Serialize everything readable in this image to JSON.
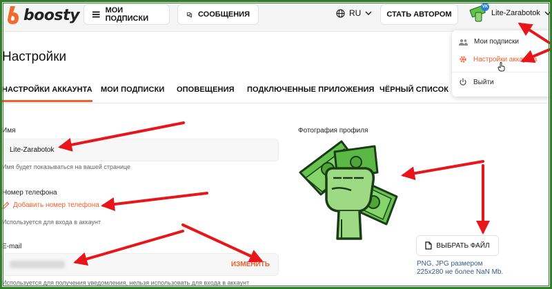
{
  "header": {
    "logo_text": "boosty",
    "nav": {
      "subscriptions": "МОИ ПОДПИСКИ",
      "messages": "СООБЩЕНИЯ"
    },
    "language": "RU",
    "become_author": "СТАТЬ АВТОРОМ",
    "username": "Lite-Zarabotok",
    "avatar_badge": "VK"
  },
  "page": {
    "title": "Настройки"
  },
  "tabs": [
    {
      "label": "НАСТРОЙКИ АККАУНТА",
      "active": true
    },
    {
      "label": "МОИ ПОДПИСКИ"
    },
    {
      "label": "ОПОВЕЩЕНИЯ"
    },
    {
      "label": "ПОДКЛЮЧЕННЫЕ ПРИЛОЖЕНИЯ"
    },
    {
      "label": "ЧЁРНЫЙ СПИСОК"
    }
  ],
  "dropdown": {
    "items": [
      {
        "label": "Мои подписки",
        "icon": "people-icon"
      },
      {
        "label": "Настройки аккаунта",
        "icon": "gear-icon",
        "active": true
      },
      {
        "label": "Выйти",
        "icon": "power-icon"
      }
    ]
  },
  "form": {
    "name_label": "Имя",
    "name_value": "Lite-Zarabotok",
    "name_hint": "Имя будет показываться на вашей странице",
    "phone_label": "Номер телефона",
    "phone_add": "Добавить номер телефона",
    "phone_hint": "Используется для входа в аккаунт",
    "email_label": "E-mail",
    "email_change": "ИЗМЕНИТЬ",
    "email_hint": "Используется для получения уведомления, нельзя использовать для входа в аккаунт"
  },
  "profile_photo": {
    "label": "Фотография профиля",
    "choose_button": "ВЫБРАТЬ ФАЙЛ",
    "hint_line1": "PNG, JPG размером",
    "hint_line2": "225x280 не более NaN Mb."
  },
  "colors": {
    "accent": "#f15f2c",
    "annotation_arrow": "#e8161b",
    "frame": "#2f7d2b"
  }
}
